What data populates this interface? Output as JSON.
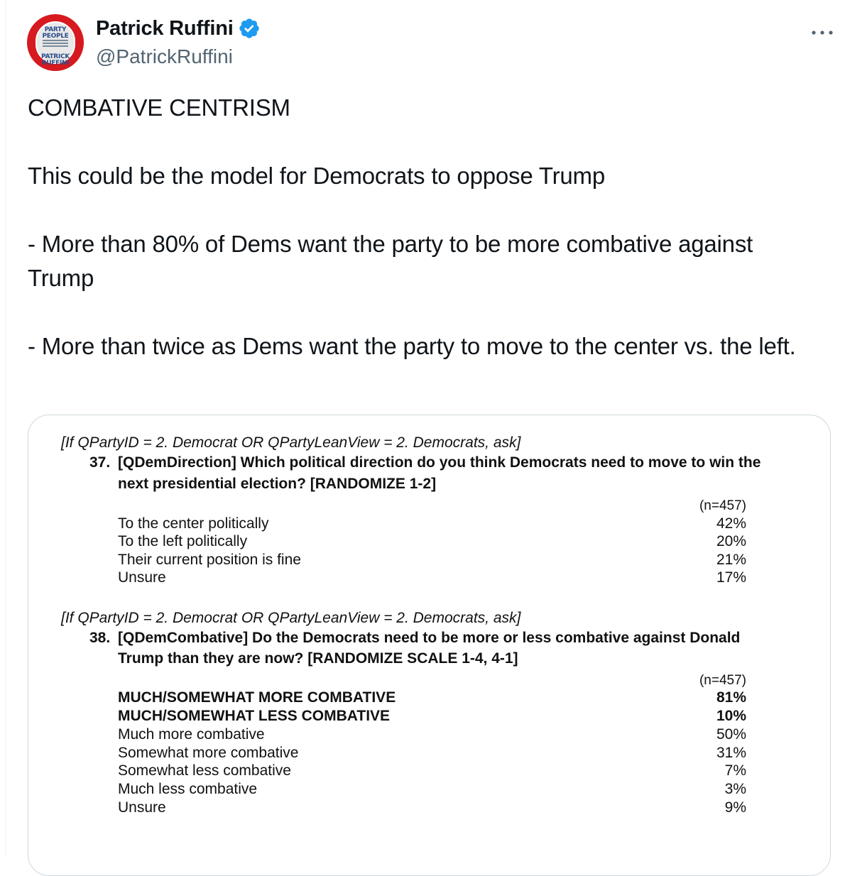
{
  "author": {
    "display_name": "Patrick Ruffini",
    "handle": "@PatrickRuffini",
    "avatar_text_top": "PARTY PEOPLE",
    "avatar_text_bottom": "PATRICK RUFFINI",
    "verified_color": "#1d9bf0"
  },
  "tweet": {
    "lines": [
      "COMBATIVE CENTRISM",
      "This could be the model for Democrats to oppose Trump",
      "- More than 80% of Dems want the party to be more combative against Trump",
      "- More than twice as Dems want the party to move to the center vs. the left."
    ]
  },
  "media": {
    "q37": {
      "condition": "[If QPartyID = 2. Democrat OR QPartyLeanView = 2. Democrats, ask]",
      "number": "37.",
      "line1": "[QDemDirection] Which political direction do you think Democrats need to move to win the",
      "line2": "next presidential election? [RANDOMIZE 1-2]",
      "n": "(n=457)",
      "rows": [
        {
          "label": "To the center politically",
          "value": "42%"
        },
        {
          "label": "To the left politically",
          "value": "20%"
        },
        {
          "label": "Their current position is fine",
          "value": "21%"
        },
        {
          "label": "Unsure",
          "value": "17%"
        }
      ]
    },
    "q38": {
      "condition": "[If QPartyID = 2. Democrat OR QPartyLeanView = 2. Democrats, ask]",
      "number": "38.",
      "line1": "[QDemCombative] Do the Democrats need to be more or less combative against Donald",
      "line2": "Trump than they are now? [RANDOMIZE SCALE 1-4, 4-1]",
      "n": "(n=457)",
      "rows": [
        {
          "label": "MUCH/SOMEWHAT MORE COMBATIVE",
          "value": "81%"
        },
        {
          "label": "MUCH/SOMEWHAT LESS COMBATIVE",
          "value": "10%"
        },
        {
          "label": "Much more combative",
          "value": "50%"
        },
        {
          "label": "Somewhat more combative",
          "value": "31%"
        },
        {
          "label": "Somewhat less combative",
          "value": "7%"
        },
        {
          "label": "Much less combative",
          "value": "3%"
        },
        {
          "label": "Unsure",
          "value": "9%"
        }
      ]
    }
  }
}
